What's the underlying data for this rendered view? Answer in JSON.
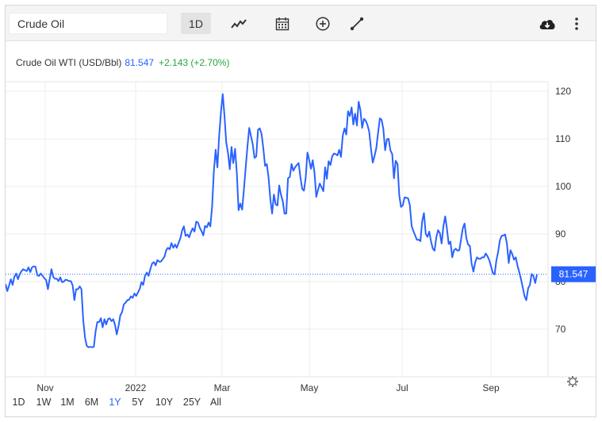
{
  "toolbar": {
    "search_value": "Crude Oil",
    "interval_label": "1D",
    "icons": [
      "line-chart-icon",
      "calendar-icon",
      "plus-circle-icon",
      "draw-line-icon",
      "cloud-download-icon",
      "more-vertical-icon"
    ]
  },
  "header": {
    "symbol": "Crude Oil WTI (USD/Bbl)",
    "last": "81.547",
    "change": "+2.143 (+2.70%)"
  },
  "colors": {
    "line": "#2962ff",
    "up": "#26a63c",
    "symbol_text": "#333333",
    "price_tag_bg": "#2962ff"
  },
  "price_tag": "81.547",
  "ranges": [
    "1D",
    "1W",
    "1M",
    "6M",
    "1Y",
    "5Y",
    "10Y",
    "25Y",
    "All"
  ],
  "active_range": "1Y",
  "chart_data": {
    "type": "line",
    "y_ticks": [
      "120",
      "110",
      "100",
      "90",
      "80",
      "70"
    ],
    "x_ticks": [
      "Nov",
      "2022",
      "Mar",
      "May",
      "Jul",
      "Sep"
    ],
    "ylim": [
      61,
      127
    ],
    "grid": true,
    "series": [
      {
        "values": [
          79.5,
          78,
          79.2,
          80.5,
          79.3,
          81,
          81.7,
          80.5,
          81.5,
          82.2,
          82.6,
          82.4,
          82.2,
          83,
          82,
          83,
          83.2,
          83.1,
          81.3,
          81.2,
          81.7,
          81.2,
          80.7,
          80.3,
          78.4,
          80.5,
          82.6,
          81,
          80.6,
          80.6,
          80.1,
          80.9,
          79.9,
          80,
          80.4,
          80.3,
          80.1,
          80.1,
          79.2,
          76.1,
          78.4,
          78.4,
          79,
          78.4,
          72,
          68.2,
          66.5,
          66.2,
          66.3,
          66.2,
          66.3,
          69.5,
          71.5,
          71.5,
          72.3,
          70.4,
          72.1,
          71,
          72.1,
          72.3,
          71.7,
          72.1,
          70.9,
          68.9,
          70.7,
          72.9,
          73.6,
          75.2,
          75.6,
          76.1,
          76.2,
          76.9,
          76.6,
          77.5,
          77,
          77.7,
          78.5,
          79.9,
          79.3,
          81.2,
          81.9,
          81.2,
          82.6,
          83.8,
          84.1,
          83.4,
          84.5,
          84.2,
          84.2,
          84.7,
          85.2,
          86.6,
          87.1,
          86.8,
          88.1,
          87.1,
          87.8,
          87.1,
          88.1,
          89.1,
          90.7,
          91.6,
          89.6,
          89.9,
          89.3,
          90.4,
          91.2,
          90.5,
          92.6,
          92.4,
          91.3,
          90.6,
          89.7,
          91.7,
          91.4,
          92.4,
          91.6,
          95.7,
          103.4,
          107.7,
          104,
          110.6,
          115.7,
          119.4,
          114.9,
          109.3,
          107,
          103.6,
          108.3,
          104.9,
          107.9,
          102.8,
          95,
          96.4,
          95.1,
          99.3,
          103.8,
          108.4,
          112.3,
          110.6,
          108.9,
          106,
          106.3,
          111.9,
          112.2,
          111,
          108,
          104.3,
          104.7,
          101.7,
          97.2,
          94.3,
          98.3,
          96.2,
          96,
          100.2,
          98.3,
          96.9,
          94.3,
          94.3,
          101.7,
          102,
          104.7,
          103.3,
          104,
          104.5,
          104.9,
          102,
          99.5,
          99.1,
          101.8,
          107.1,
          105.5,
          103.7,
          105.5,
          102.9,
          97.8,
          99.3,
          100.6,
          99.8,
          99,
          104,
          101.6,
          105.3,
          104.5,
          106.3,
          106.9,
          106.8,
          106.5,
          107.7,
          106.2,
          110.6,
          112.2,
          110.9,
          115.8,
          114.8,
          116.6,
          113,
          115.3,
          112.8,
          117.8,
          116,
          112.3,
          114.2,
          113.8,
          112.9,
          111.5,
          107.8,
          105,
          106.4,
          108,
          111.3,
          114.3,
          114,
          112.1,
          107.6,
          109.9,
          110,
          107.6,
          106.8,
          101.7,
          105.4,
          104.7,
          98.1,
          95.7,
          96,
          97.7,
          97.6,
          97.5,
          96.1,
          91.7,
          90.6,
          89.7,
          88.8,
          88.8,
          88.5,
          92.7,
          94.4,
          90,
          89.4,
          90.5,
          88.5,
          86.9,
          86.5,
          89.3,
          90.8,
          90.2,
          88,
          91.6,
          93.7,
          91.1,
          87.9,
          88.4,
          85.1,
          86.6,
          86.9,
          86.5,
          86.6,
          88.9,
          91.2,
          92.2,
          89.1,
          87.8,
          87.5,
          83.8,
          82.1,
          84,
          85.1,
          84.8,
          84.8,
          85.1,
          85.1,
          85.9,
          85.3,
          84.5,
          83.2,
          81.8,
          81.5,
          84.4,
          86.2,
          88.7,
          89.6,
          89.7,
          89.9,
          87.9,
          83.9,
          86.6,
          85.8,
          84.6,
          85.1,
          83.3,
          82,
          80.4,
          78.7,
          76.9,
          76.1,
          78.6,
          79.3,
          81.6,
          81.2,
          79.7,
          81.5
        ]
      }
    ]
  }
}
